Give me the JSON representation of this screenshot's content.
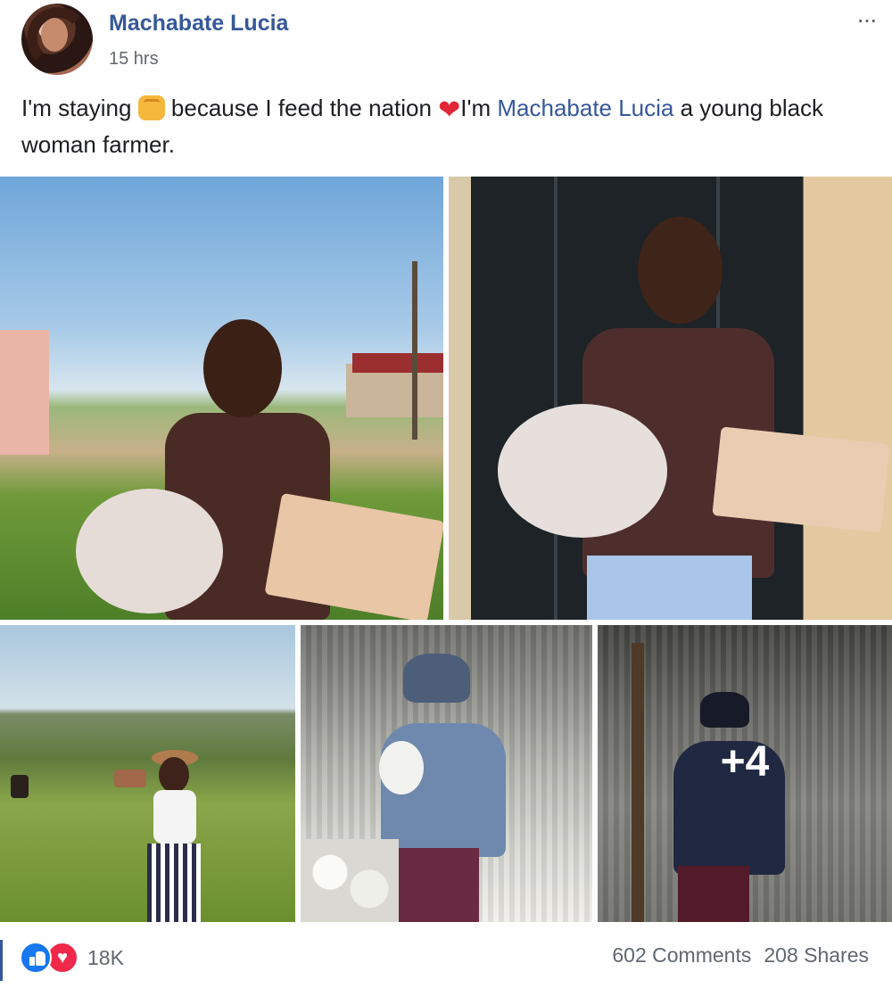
{
  "post": {
    "author": "Machabate Lucia",
    "timestamp": "15 hrs",
    "more_icon": "···",
    "text": {
      "part1": "I'm staying ",
      "part2": " because I feed the nation ",
      "part3": "I'm ",
      "mention": "Machabate Lucia",
      "part4": " a young black woman farmer."
    },
    "photos": {
      "more_count": "+4"
    },
    "reactions": {
      "count": "18K",
      "love_symbol": "♥"
    },
    "stats": {
      "comments": "602 Comments",
      "shares": "208 Shares"
    }
  },
  "colors": {
    "link": "#365899",
    "like": "#1877f2",
    "love": "#f0284a",
    "heart_emoji": "#e32636"
  }
}
